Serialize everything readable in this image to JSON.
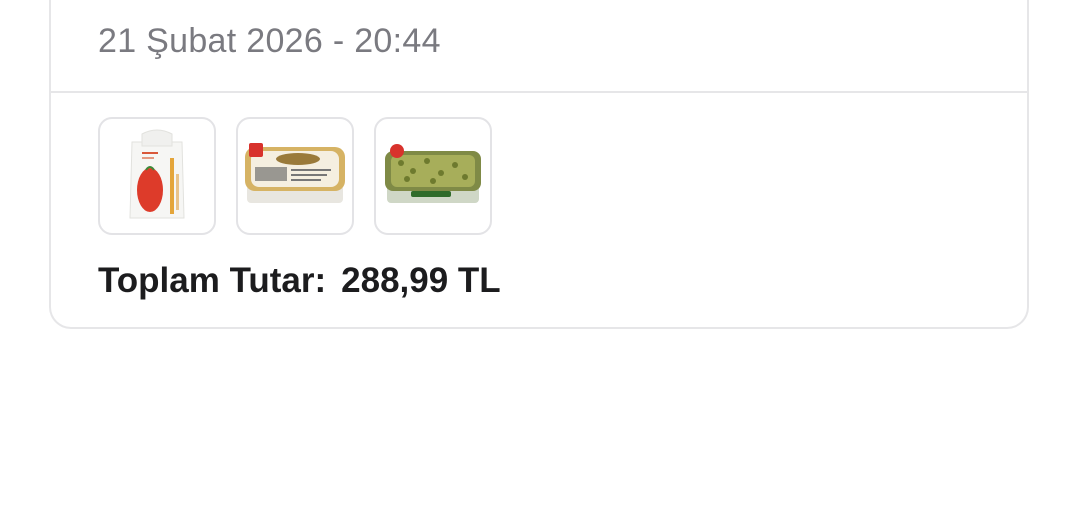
{
  "order": {
    "date": "21 Şubat 2026 - 20:44",
    "total_label": "Toplam Tutar:",
    "total_value": "288,99 TL",
    "products": [
      {
        "icon": "shopping-bag-image"
      },
      {
        "icon": "cheese-tub-image"
      },
      {
        "icon": "olive-tray-image"
      }
    ]
  },
  "colors": {
    "text_primary": "#1c1c1e",
    "text_secondary": "#7a7a80",
    "link": "#2f6fde",
    "border": "#e6e6e8"
  }
}
